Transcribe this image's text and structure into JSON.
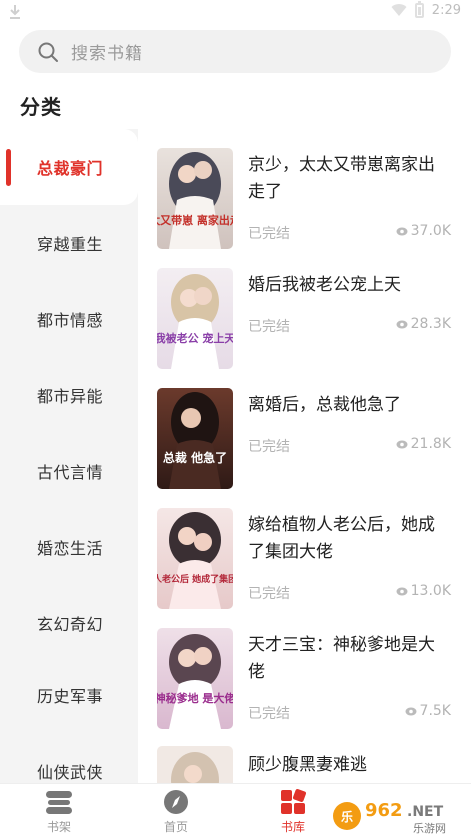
{
  "status_bar": {
    "time": "2:29"
  },
  "search": {
    "placeholder": "搜索书籍"
  },
  "section_title": "分类",
  "categories": [
    {
      "label": "总裁豪门",
      "active": true
    },
    {
      "label": "穿越重生",
      "active": false
    },
    {
      "label": "都市情感",
      "active": false
    },
    {
      "label": "都市异能",
      "active": false
    },
    {
      "label": "古代言情",
      "active": false
    },
    {
      "label": "婚恋生活",
      "active": false
    },
    {
      "label": "玄幻奇幻",
      "active": false
    },
    {
      "label": "历史军事",
      "active": false
    },
    {
      "label": "仙侠武侠",
      "active": false
    }
  ],
  "books": [
    {
      "title": "京少，太太又带崽离家出走了",
      "status": "已完结",
      "views": "37.0K",
      "cover_text": "太太又带崽 离家出走了"
    },
    {
      "title": "婚后我被老公宠上天",
      "status": "已完结",
      "views": "28.3K",
      "cover_text": "我被老公 宠上天"
    },
    {
      "title": "离婚后，总裁他急了",
      "status": "已完结",
      "views": "21.8K",
      "cover_text": "总裁 他急了"
    },
    {
      "title": "嫁给植物人老公后，她成了集团大佬",
      "status": "已完结",
      "views": "13.0K",
      "cover_text": "植物人老公后 她成了集团大佬"
    },
    {
      "title": "天才三宝：神秘爹地是大佬",
      "status": "已完结",
      "views": "7.5K",
      "cover_text": "神秘爹地 是大佬"
    },
    {
      "title": "顾少腹黑妻难逃",
      "status": "",
      "views": "",
      "cover_text": ""
    }
  ],
  "bottom_nav": [
    {
      "label": "书架",
      "icon": "bookshelf-icon",
      "active": false
    },
    {
      "label": "首页",
      "icon": "compass-icon",
      "active": false
    },
    {
      "label": "书库",
      "icon": "library-grid-icon",
      "active": true
    }
  ],
  "watermark": {
    "text": "962.NET",
    "subtext": "乐游网"
  },
  "colors": {
    "accent": "#e0322a",
    "sidebar_bg": "#f4f4f4",
    "muted": "#b3b3b3"
  }
}
